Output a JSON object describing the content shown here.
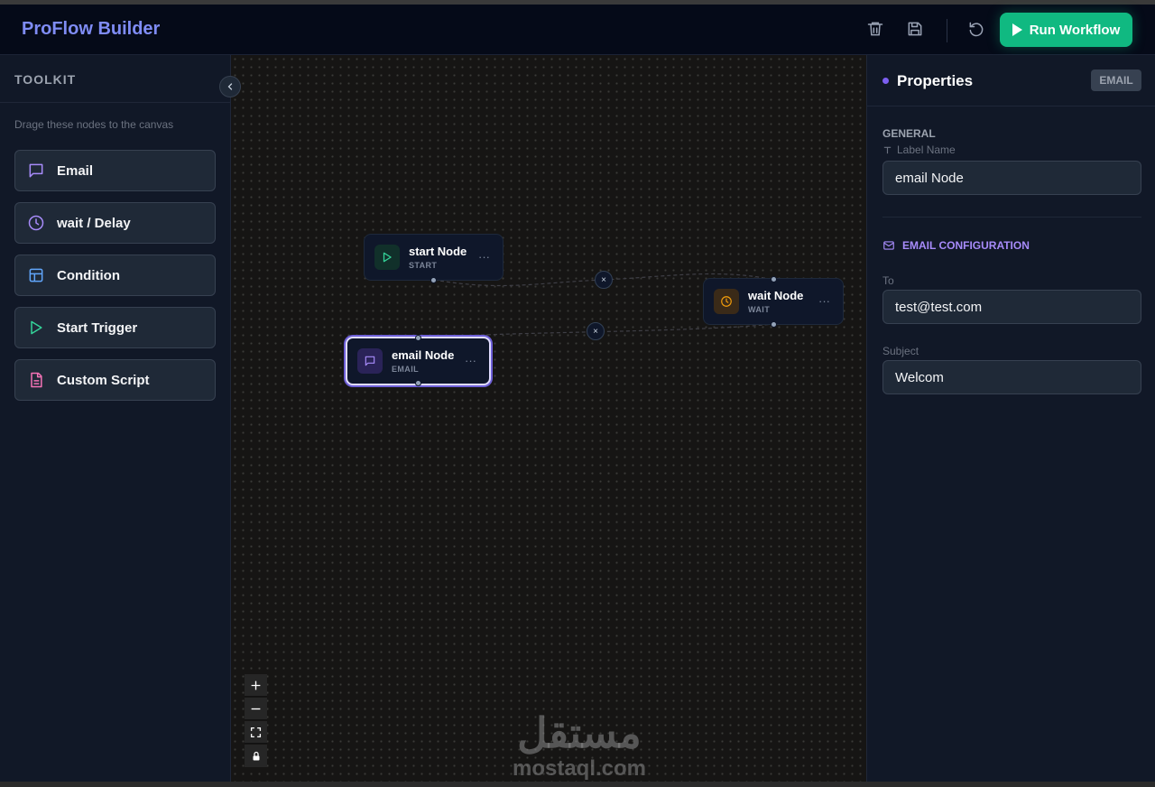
{
  "header": {
    "brand": "ProFlow Builder",
    "run_label": "Run Workflow",
    "icons": [
      "trash-icon",
      "save-icon",
      "undo-icon",
      "play-icon"
    ],
    "colors": {
      "brand": "#7f8cf5",
      "run": "#10b981"
    }
  },
  "toolkit": {
    "title": "TOOLKIT",
    "hint": "Drage these nodes to the canvas",
    "items": [
      {
        "label": "Email",
        "icon": "message-icon",
        "color": "#a78bfa"
      },
      {
        "label": "wait / Delay",
        "icon": "clock-icon",
        "color": "#a78bfa"
      },
      {
        "label": "Condition",
        "icon": "layout-icon",
        "color": "#60a5fa"
      },
      {
        "label": "Start Trigger",
        "icon": "play-icon",
        "color": "#34d399"
      },
      {
        "label": "Custom Script",
        "icon": "file-icon",
        "color": "#f472b6"
      }
    ]
  },
  "canvas": {
    "nodes": [
      {
        "title": "start Node",
        "type": "START",
        "icon": "play-icon"
      },
      {
        "title": "email Node",
        "type": "EMAIL",
        "icon": "message-icon"
      },
      {
        "title": "wait Node",
        "type": "WAIT",
        "icon": "clock-icon"
      }
    ],
    "node_menu": "···",
    "edge_delete": "×",
    "controls": [
      "zoom-in",
      "zoom-out",
      "fit-view",
      "lock"
    ],
    "watermark": {
      "arabic": "مستقل",
      "latin": "mostaql.com"
    }
  },
  "properties": {
    "title": "Properties",
    "tag": "EMAIL",
    "general_title": "GENERAL",
    "label_name_label": "Label Name",
    "label_name_value": "email Node",
    "email_config_title": "EMAIL CONFIGURATION",
    "to_label": "To",
    "to_value": "test@test.com",
    "subject_label": "Subject",
    "subject_value": "Welcom"
  }
}
